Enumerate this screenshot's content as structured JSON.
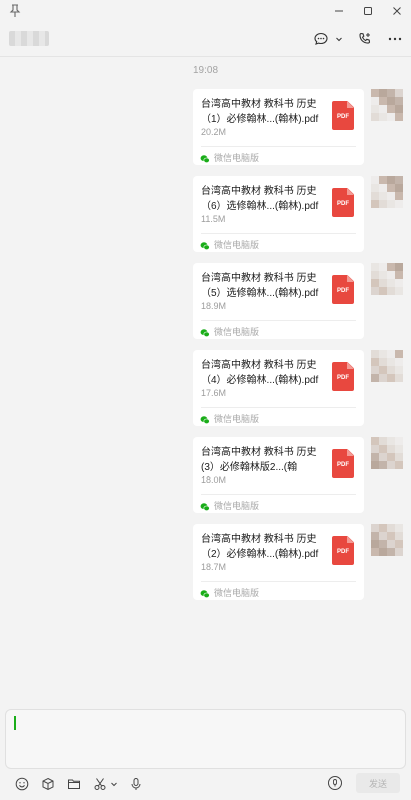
{
  "window": {
    "pin_icon": "pin-icon",
    "controls": [
      "minimize-icon",
      "maximize-icon",
      "close-icon"
    ]
  },
  "header": {
    "contact_name_blurred": true,
    "icons": [
      "chat-bubble-icon",
      "chevron-down-icon",
      "phone-icon",
      "more-icon"
    ]
  },
  "chat": {
    "timestamp": "19:08",
    "messages": [
      {
        "file_line1": "台湾高中教材 教科书 历史",
        "file_line2": "（1）必修翰林...(翰林).pdf",
        "size": "20.2M",
        "type_label": "PDF",
        "source": "微信电脑版"
      },
      {
        "file_line1": "台湾高中教材 教科书 历史",
        "file_line2": "（6）选修翰林...(翰林).pdf",
        "size": "11.5M",
        "type_label": "PDF",
        "source": "微信电脑版"
      },
      {
        "file_line1": "台湾高中教材 教科书 历史",
        "file_line2": "（5）选修翰林...(翰林).pdf",
        "size": "18.9M",
        "type_label": "PDF",
        "source": "微信电脑版"
      },
      {
        "file_line1": "台湾高中教材 教科书 历史",
        "file_line2": "（4）必修翰林...(翰林).pdf",
        "size": "17.6M",
        "type_label": "PDF",
        "source": "微信电脑版"
      },
      {
        "file_line1": "台湾高中教材 教科书 历史",
        "file_line2": "(3）必修翰林版2...(翰林).pdf",
        "size": "18.0M",
        "type_label": "PDF",
        "source": "微信电脑版"
      },
      {
        "file_line1": "台湾高中教材 教科书 历史",
        "file_line2": "（2）必修翰林...(翰林).pdf",
        "size": "18.7M",
        "type_label": "PDF",
        "source": "微信电脑版"
      }
    ]
  },
  "input": {
    "value": "",
    "toolbar_icons": [
      "emoji-icon",
      "box-icon",
      "folder-icon",
      "scissors-icon",
      "chevron-down-icon",
      "microphone-icon"
    ],
    "send_label": "发送"
  },
  "colors": {
    "background": "#f3f3f3",
    "bubble": "#ffffff",
    "pdf_red": "#e8483f",
    "wechat_green": "#1aad19"
  }
}
